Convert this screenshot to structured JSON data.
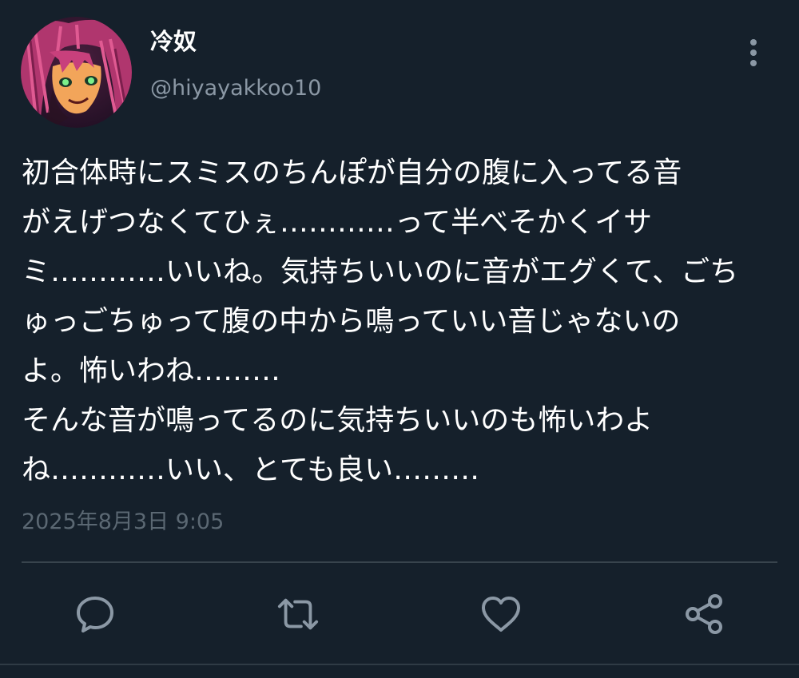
{
  "colors": {
    "background": "#15202b",
    "text_primary": "#ffffff",
    "text_secondary": "#8b98a5",
    "timestamp": "#5b6873",
    "icon": "#8b98a5",
    "divider": "#38444d"
  },
  "user": {
    "display_name": "冷奴",
    "handle": "@hiyayakkoo10",
    "avatar_icon": "anime-character-avatar"
  },
  "tweet": {
    "lines": [
      "初合体時にスミスのちんぽが自分の腹に入ってる音",
      "がえげつなくてひぇ…………って半べそかくイサ",
      "ミ…………いいね。気持ちいいのに音がエグくて、ごち",
      "ゅっごちゅって腹の中から鳴っていい音じゃないの",
      "よ。怖いわね………",
      "そんな音が鳴ってるのに気持ちいいのも怖いわよ",
      "ね…………いい、とても良い………"
    ],
    "timestamp": "2025年8月3日 9:05"
  },
  "actions": {
    "icons": [
      "reply-icon",
      "retweet-icon",
      "like-icon",
      "share-icon"
    ]
  },
  "menu": {
    "icon": "more-vertical-icon"
  }
}
